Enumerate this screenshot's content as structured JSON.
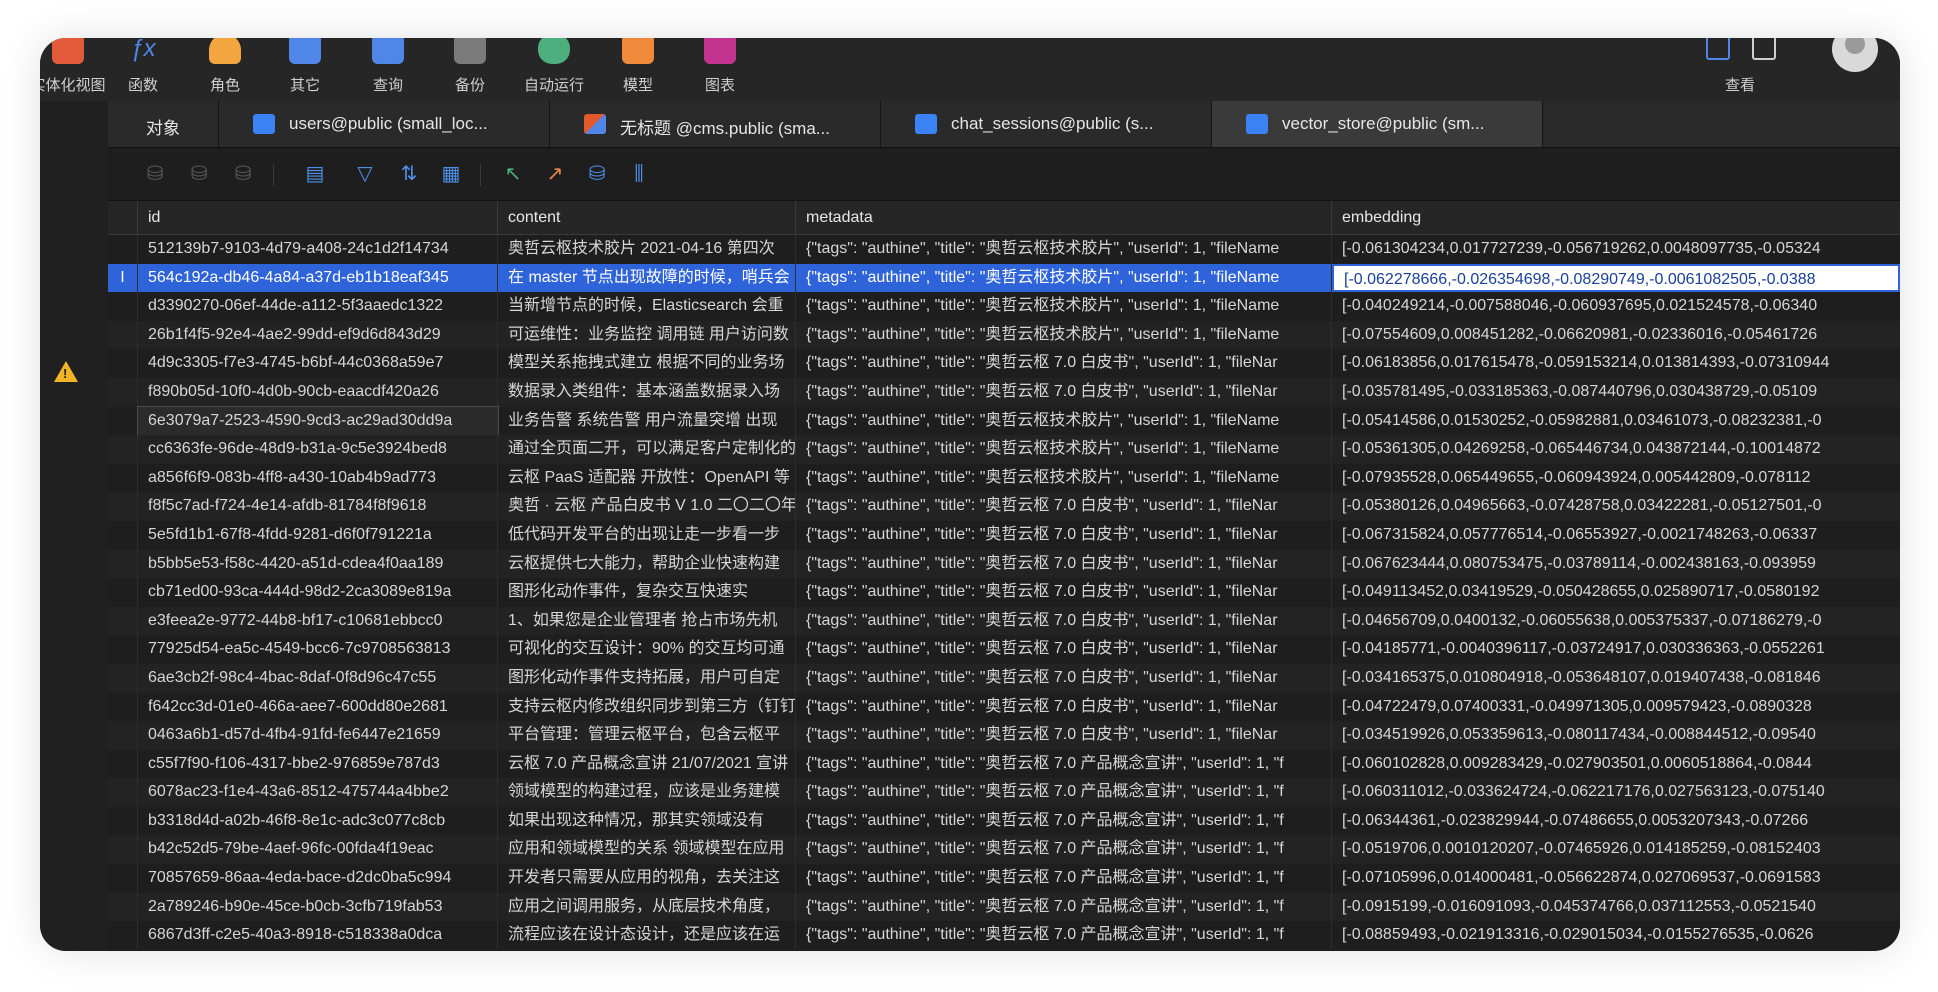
{
  "toolbar": {
    "items": [
      {
        "label": "实体化视图",
        "icon": "materialized-view-icon",
        "color": "#e45b3c"
      },
      {
        "label": "函数",
        "icon": "function-icon",
        "color": "#4f86e8"
      },
      {
        "label": "角色",
        "icon": "role-icon",
        "color": "#f3a640"
      },
      {
        "label": "其它",
        "icon": "other-icon",
        "color": "#4f86e8"
      },
      {
        "label": "查询",
        "icon": "query-icon",
        "color": "#4f86e8"
      },
      {
        "label": "备份",
        "icon": "backup-icon",
        "color": "#8a8a8a"
      },
      {
        "label": "自动运行",
        "icon": "automation-icon",
        "color": "#4caf7d"
      },
      {
        "label": "模型",
        "icon": "model-icon",
        "color": "#f08a3a"
      },
      {
        "label": "图表",
        "icon": "chart-icon",
        "color": "#c2358f"
      }
    ],
    "view_label": "查看"
  },
  "tabs": [
    {
      "label": "对象",
      "icon": "objects-tab"
    },
    {
      "label": "users@public (small_loc...",
      "icon": "table-icon"
    },
    {
      "label": "无标题 @cms.public (sma...",
      "icon": "query-icon"
    },
    {
      "label": "chat_sessions@public (s...",
      "icon": "table-icon"
    },
    {
      "label": "vector_store@public (sm...",
      "icon": "table-icon"
    }
  ],
  "grid": {
    "columns": [
      "id",
      "content",
      "metadata",
      "embedding"
    ],
    "rows": [
      {
        "id": "512139b7-9103-4d79-a408-24c1d2f14734",
        "content": "奥哲云枢技术胶片 2021-04-16 第四次",
        "metadata": "{\"tags\": \"authine\", \"title\": \"奥哲云枢技术胶片\", \"userId\": 1, \"fileName",
        "embedding": "[-0.061304234,0.017727239,-0.056719262,0.0048097735,-0.05324"
      },
      {
        "id": "564c192a-db46-4a84-a37d-eb1b18eaf345",
        "content": "在 master 节点出现故障的时候，哨兵会",
        "metadata": "{\"tags\": \"authine\", \"title\": \"奥哲云枢技术胶片\", \"userId\": 1, \"fileName",
        "embedding": "[-0.062278666,-0.026354698,-0.08290749,-0.0061082505,-0.0388"
      },
      {
        "id": "d3390270-06ef-44de-a112-5f3aaedc1322",
        "content": "当新增节点的时候，Elasticsearch 会重",
        "metadata": "{\"tags\": \"authine\", \"title\": \"奥哲云枢技术胶片\", \"userId\": 1, \"fileName",
        "embedding": "[-0.040249214,-0.007588046,-0.060937695,0.021524578,-0.06340"
      },
      {
        "id": "26b1f4f5-92e4-4ae2-99dd-ef9d6d843d29",
        "content": "可运维性：业务监控 调用链 用户访问数",
        "metadata": "{\"tags\": \"authine\", \"title\": \"奥哲云枢技术胶片\", \"userId\": 1, \"fileName",
        "embedding": "[-0.07554609,0.008451282,-0.06620981,-0.02336016,-0.05461726"
      },
      {
        "id": "4d9c3305-f7e3-4745-b6bf-44c0368a59e7",
        "content": "模型关系拖拽式建立 根据不同的业务场",
        "metadata": "{\"tags\": \"authine\", \"title\": \"奥哲云枢 7.0 白皮书\", \"userId\": 1, \"fileNar",
        "embedding": "[-0.06183856,0.017615478,-0.059153214,0.013814393,-0.07310944"
      },
      {
        "id": "f890b05d-10f0-4d0b-90cb-eaacdf420a26",
        "content": "数据录入类组件：基本涵盖数据录入场",
        "metadata": "{\"tags\": \"authine\", \"title\": \"奥哲云枢 7.0 白皮书\", \"userId\": 1, \"fileNar",
        "embedding": "[-0.035781495,-0.033185363,-0.087440796,0.030438729,-0.05109"
      },
      {
        "id": "6e3079a7-2523-4590-9cd3-ac29ad30dd9a",
        "content": "业务告警 系统告警 用户流量突增 出现",
        "metadata": "{\"tags\": \"authine\", \"title\": \"奥哲云枢技术胶片\", \"userId\": 1, \"fileName",
        "embedding": "[-0.05414586,0.01530252,-0.05982881,0.03461073,-0.08232381,-0"
      },
      {
        "id": "cc6363fe-96de-48d9-b31a-9c5e3924bed8",
        "content": "通过全页面二开，可以满足客户定制化的",
        "metadata": "{\"tags\": \"authine\", \"title\": \"奥哲云枢技术胶片\", \"userId\": 1, \"fileName",
        "embedding": "[-0.05361305,0.04269258,-0.065446734,0.043872144,-0.10014872"
      },
      {
        "id": "a856f6f9-083b-4ff8-a430-10ab4b9ad773",
        "content": "云枢 PaaS 适配器 开放性：OpenAPI 等",
        "metadata": "{\"tags\": \"authine\", \"title\": \"奥哲云枢技术胶片\", \"userId\": 1, \"fileName",
        "embedding": "[-0.07935528,0.065449655,-0.060943924,0.005442809,-0.078112"
      },
      {
        "id": "f8f5c7ad-f724-4e14-afdb-81784f8f9618",
        "content": "奥哲 · 云枢 产品白皮书 V 1.0 二〇二〇年",
        "metadata": "{\"tags\": \"authine\", \"title\": \"奥哲云枢 7.0 白皮书\", \"userId\": 1, \"fileNar",
        "embedding": "[-0.05380126,0.04965663,-0.07428758,0.03422281,-0.05127501,-0"
      },
      {
        "id": "5e5fd1b1-67f8-4fdd-9281-d6f0f791221a",
        "content": "低代码开发平台的出现让走一步看一步",
        "metadata": "{\"tags\": \"authine\", \"title\": \"奥哲云枢 7.0 白皮书\", \"userId\": 1, \"fileNar",
        "embedding": "[-0.067315824,0.057776514,-0.06553927,-0.0021748263,-0.06337"
      },
      {
        "id": "b5bb5e53-f58c-4420-a51d-cdea4f0aa189",
        "content": "云枢提供七大能力，帮助企业快速构建",
        "metadata": "{\"tags\": \"authine\", \"title\": \"奥哲云枢 7.0 白皮书\", \"userId\": 1, \"fileNar",
        "embedding": "[-0.067623444,0.080753475,-0.03789114,-0.002438163,-0.093959"
      },
      {
        "id": "cb71ed00-93ca-444d-98d2-2ca3089e819a",
        "content": "图形化动作事件，复杂交互快速实",
        "metadata": "{\"tags\": \"authine\", \"title\": \"奥哲云枢 7.0 白皮书\", \"userId\": 1, \"fileNar",
        "embedding": "[-0.049113452,0.03419529,-0.050428655,0.025890717,-0.0580192"
      },
      {
        "id": "e3feea2e-9772-44b8-bf17-c10681ebbcc0",
        "content": "1、如果您是企业管理者 抢占市场先机",
        "metadata": "{\"tags\": \"authine\", \"title\": \"奥哲云枢 7.0 白皮书\", \"userId\": 1, \"fileNar",
        "embedding": "[-0.04656709,0.0400132,-0.06055638,0.005375337,-0.07186279,-0"
      },
      {
        "id": "77925d54-ea5c-4549-bcc6-7c9708563813",
        "content": "可视化的交互设计：90% 的交互均可通",
        "metadata": "{\"tags\": \"authine\", \"title\": \"奥哲云枢 7.0 白皮书\", \"userId\": 1, \"fileNar",
        "embedding": "[-0.04185771,-0.0040396117,-0.03724917,0.030336363,-0.0552261"
      },
      {
        "id": "6ae3cb2f-98c4-4bac-8daf-0f8d96c47c55",
        "content": "图形化动作事件支持拓展，用户可自定",
        "metadata": "{\"tags\": \"authine\", \"title\": \"奥哲云枢 7.0 白皮书\", \"userId\": 1, \"fileNar",
        "embedding": "[-0.034165375,0.010804918,-0.053648107,0.019407438,-0.081846"
      },
      {
        "id": "f642cc3d-01e0-466a-aee7-600dd80e2681",
        "content": "支持云枢内修改组织同步到第三方（钉钉",
        "metadata": "{\"tags\": \"authine\", \"title\": \"奥哲云枢 7.0 白皮书\", \"userId\": 1, \"fileNar",
        "embedding": "[-0.04722479,0.07400331,-0.049971305,0.009579423,-0.0890328"
      },
      {
        "id": "0463a6b1-d57d-4fb4-91fd-fe6447e21659",
        "content": "平台管理：管理云枢平台，包含云枢平",
        "metadata": "{\"tags\": \"authine\", \"title\": \"奥哲云枢 7.0 白皮书\", \"userId\": 1, \"fileNar",
        "embedding": "[-0.034519926,0.053359613,-0.080117434,-0.008844512,-0.09540"
      },
      {
        "id": "c55f7f90-f106-4317-bbe2-976859e787d3",
        "content": "云枢 7.0 产品概念宣讲 21/07/2021 宣讲",
        "metadata": "{\"tags\": \"authine\", \"title\": \"奥哲云枢 7.0 产品概念宣讲\", \"userId\": 1, \"f",
        "embedding": "[-0.060102828,0.009283429,-0.027903501,0.0060518864,-0.0844"
      },
      {
        "id": "6078ac23-f1e4-43a6-8512-475744a4bbe2",
        "content": "领域模型的构建过程，应该是业务建模",
        "metadata": "{\"tags\": \"authine\", \"title\": \"奥哲云枢 7.0 产品概念宣讲\", \"userId\": 1, \"f",
        "embedding": "[-0.060311012,-0.033624724,-0.062217176,0.027563123,-0.075140"
      },
      {
        "id": "b3318d4d-a02b-46f8-8e1c-adc3c077c8cb",
        "content": "如果出现这种情况，那其实领域没有",
        "metadata": "{\"tags\": \"authine\", \"title\": \"奥哲云枢 7.0 产品概念宣讲\", \"userId\": 1, \"f",
        "embedding": "[-0.06344361,-0.023829944,-0.07486655,0.0053207343,-0.07266"
      },
      {
        "id": "b42c52d5-79be-4aef-96fc-00fda4f19eac",
        "content": "应用和领域模型的关系 领域模型在应用",
        "metadata": "{\"tags\": \"authine\", \"title\": \"奥哲云枢 7.0 产品概念宣讲\", \"userId\": 1, \"f",
        "embedding": "[-0.0519706,0.0010120207,-0.07465926,0.014185259,-0.08152403"
      },
      {
        "id": "70857659-86aa-4eda-bace-d2dc0ba5c994",
        "content": "开发者只需要从应用的视角，去关注这",
        "metadata": "{\"tags\": \"authine\", \"title\": \"奥哲云枢 7.0 产品概念宣讲\", \"userId\": 1, \"f",
        "embedding": "[-0.07105996,0.014000481,-0.056622874,0.027069537,-0.0691583"
      },
      {
        "id": "2a789246-b90e-45ce-b0cb-3cfb719fab53",
        "content": "应用之间调用服务，从底层技术角度，",
        "metadata": "{\"tags\": \"authine\", \"title\": \"奥哲云枢 7.0 产品概念宣讲\", \"userId\": 1, \"f",
        "embedding": "[-0.0915199,-0.016091093,-0.045374766,0.037112553,-0.0521540"
      },
      {
        "id": "6867d3ff-c2e5-40a3-8918-c518338a0dca",
        "content": "流程应该在设计态设计，还是应该在运",
        "metadata": "{\"tags\": \"authine\", \"title\": \"奥哲云枢 7.0 产品概念宣讲\", \"userId\": 1, \"f",
        "embedding": "[-0.08859493,-0.021913316,-0.029015034,-0.0155276535,-0.0626"
      }
    ]
  }
}
